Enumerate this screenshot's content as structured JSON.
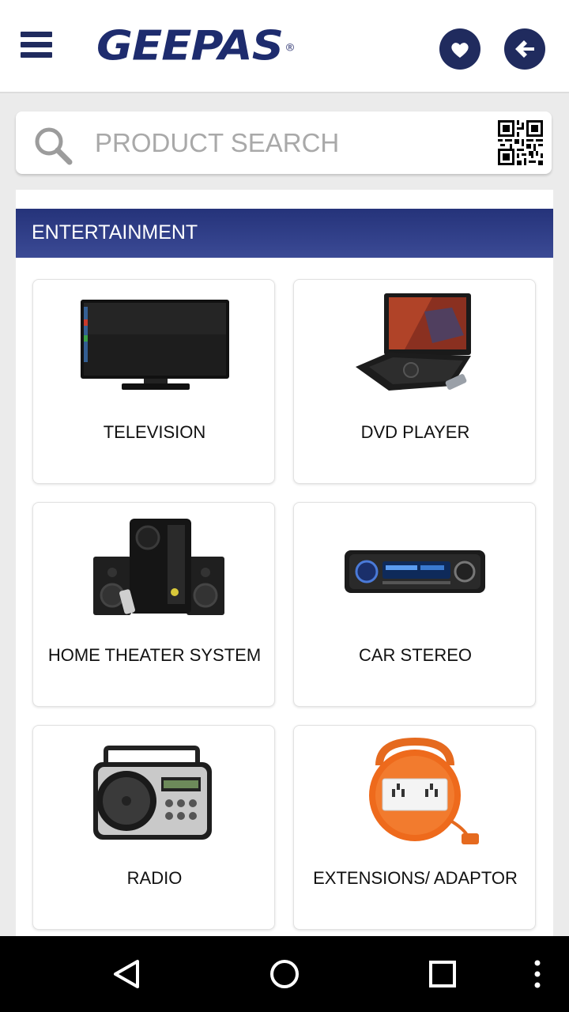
{
  "header": {
    "logo_text": "GEEPAS",
    "logo_mark": "®",
    "menu_icon": "hamburger-menu-icon",
    "favorites_icon": "heart-icon",
    "back_icon": "arrow-left-icon"
  },
  "search": {
    "placeholder": "PRODUCT SEARCH",
    "value": "",
    "search_icon": "magnifier-icon",
    "qr_icon": "qr-code-icon"
  },
  "section": {
    "title": "ENTERTAINMENT"
  },
  "products": [
    {
      "label": "TELEVISION",
      "icon": "television-image"
    },
    {
      "label": "DVD PLAYER",
      "icon": "dvd-player-image"
    },
    {
      "label": "HOME THEATER SYSTEM",
      "icon": "home-theater-image"
    },
    {
      "label": "CAR STEREO",
      "icon": "car-stereo-image"
    },
    {
      "label": "RADIO",
      "icon": "radio-image"
    },
    {
      "label": "EXTENSIONS/ ADAPTOR",
      "icon": "extension-reel-image"
    }
  ],
  "nav": {
    "back_icon": "triangle-back-icon",
    "home_icon": "circle-home-icon",
    "recents_icon": "square-recents-icon",
    "more_icon": "vertical-dots-icon"
  },
  "colors": {
    "brand_navy": "#202b5e",
    "section_bar": "#2e3c86",
    "background": "#ebebeb"
  }
}
